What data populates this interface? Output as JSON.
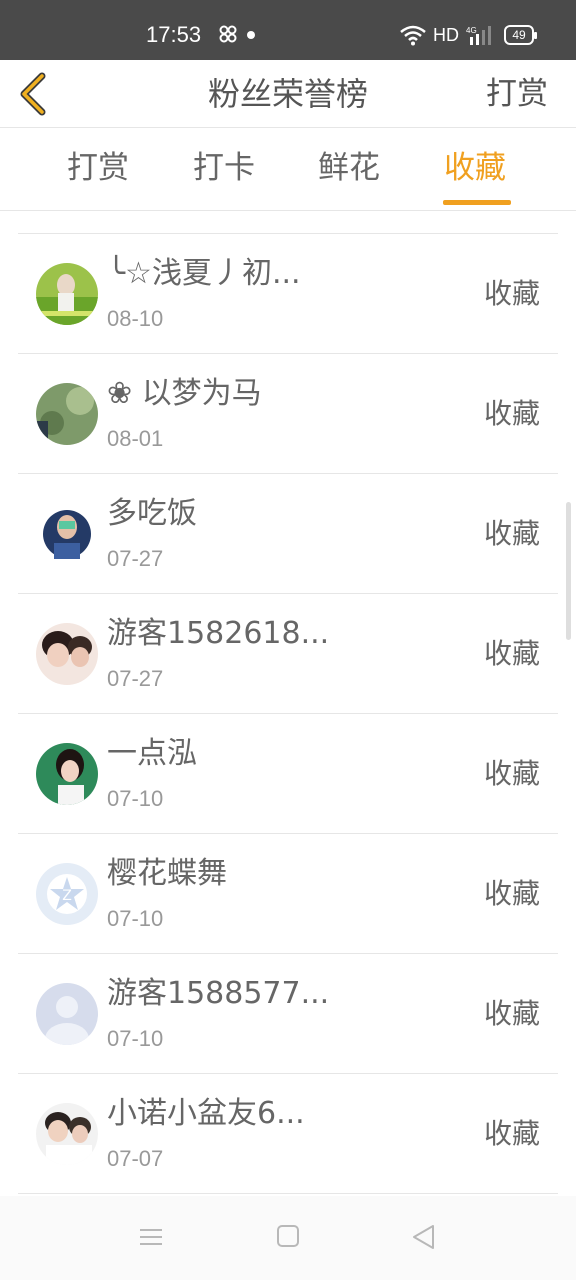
{
  "status_bar": {
    "time": "17:53",
    "network": "HD",
    "signal_label": "4G",
    "battery": "49"
  },
  "header": {
    "back_icon": "chevron-left-icon",
    "title": "粉丝荣誉榜",
    "action_label": "打赏"
  },
  "tabs": [
    {
      "label": "打赏",
      "active": false
    },
    {
      "label": "打卡",
      "active": false
    },
    {
      "label": "鲜花",
      "active": false
    },
    {
      "label": "收藏",
      "active": true
    }
  ],
  "list": [
    {
      "name": "╰☆浅夏丿初...",
      "date": "08-10",
      "action": "收藏"
    },
    {
      "name": "❀ 以梦为马",
      "date": "08-01",
      "action": "收藏"
    },
    {
      "name": "多吃饭",
      "date": "07-27",
      "action": "收藏"
    },
    {
      "name": "游客1582618...",
      "date": "07-27",
      "action": "收藏"
    },
    {
      "name": "一点泓",
      "date": "07-10",
      "action": "收藏"
    },
    {
      "name": "樱花蝶舞",
      "date": "07-10",
      "action": "收藏"
    },
    {
      "name": "游客1588577...",
      "date": "07-10",
      "action": "收藏"
    },
    {
      "name": "小诺小盆友6...",
      "date": "07-07",
      "action": "收藏"
    }
  ],
  "nav_bar": {
    "menu_icon": "menu-icon",
    "home_icon": "home-square-icon",
    "back_icon": "back-triangle-icon"
  },
  "colors": {
    "accent": "#f0a020",
    "status_bar_bg": "#4a4a4a",
    "text": "#666666",
    "subtext": "#999999"
  }
}
